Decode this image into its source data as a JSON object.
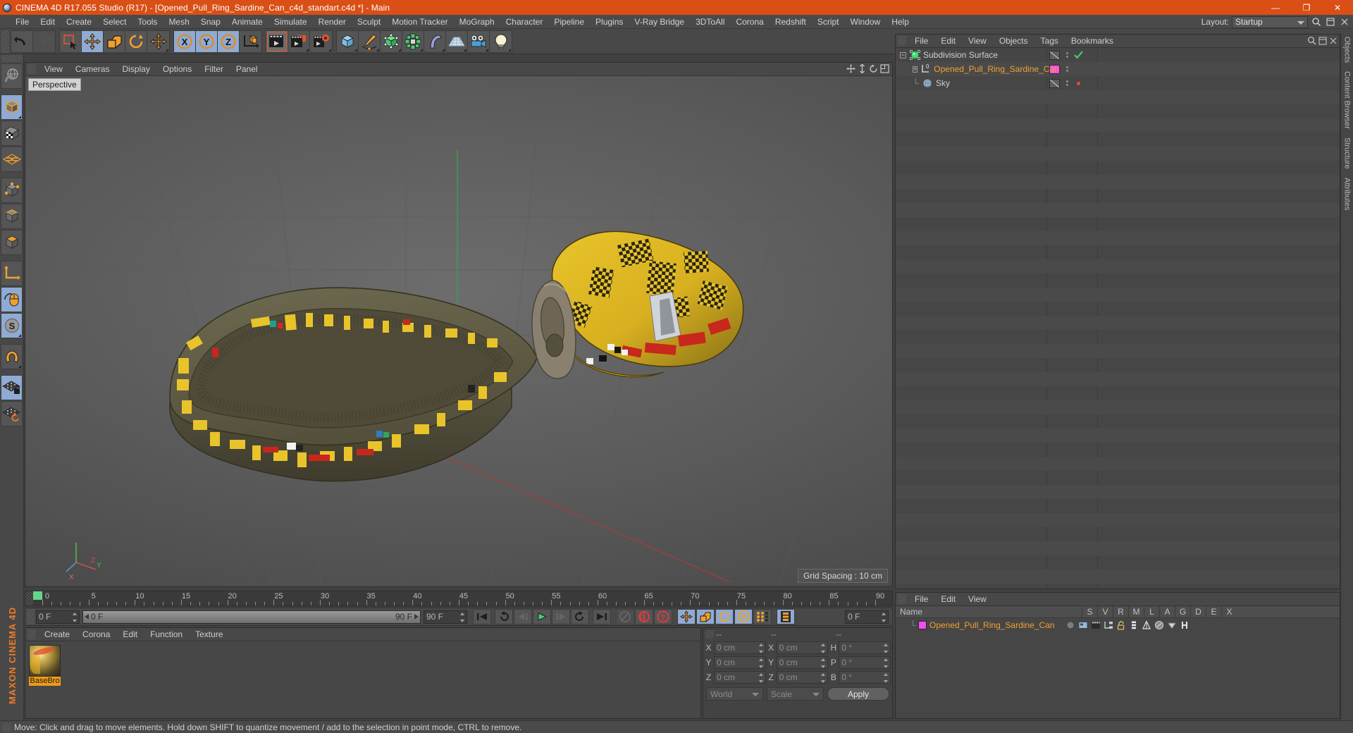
{
  "window": {
    "title": "CINEMA 4D R17.055 Studio (R17) - [Opened_Pull_Ring_Sardine_Can_c4d_standart.c4d *] - Main",
    "minimize": "—",
    "maximize": "❐",
    "close": "✕",
    "accent_color": "#d94f15"
  },
  "menubar": {
    "items": [
      {
        "label": "File"
      },
      {
        "label": "Edit"
      },
      {
        "label": "Create"
      },
      {
        "label": "Select"
      },
      {
        "label": "Tools"
      },
      {
        "label": "Mesh"
      },
      {
        "label": "Snap"
      },
      {
        "label": "Animate"
      },
      {
        "label": "Simulate"
      },
      {
        "label": "Render"
      },
      {
        "label": "Sculpt"
      },
      {
        "label": "Motion Tracker"
      },
      {
        "label": "MoGraph"
      },
      {
        "label": "Character"
      },
      {
        "label": "Pipeline"
      },
      {
        "label": "Plugins"
      },
      {
        "label": "V-Ray Bridge"
      },
      {
        "label": "3DToAll"
      },
      {
        "label": "Corona"
      },
      {
        "label": "Redshift"
      },
      {
        "label": "Script"
      },
      {
        "label": "Window"
      },
      {
        "label": "Help"
      }
    ],
    "layout_label": "Layout:",
    "layout_value": "Startup",
    "search_icon": "search-icon"
  },
  "toolbar": {
    "groups": [
      {
        "name": "history",
        "buttons": [
          {
            "name": "undo-button",
            "icon": "undo-icon"
          },
          {
            "name": "redo-button",
            "icon": "redo-icon"
          }
        ]
      },
      {
        "name": "transform",
        "buttons": [
          {
            "name": "live-selection-button",
            "icon": "selection-icon"
          },
          {
            "name": "move-tool-button",
            "icon": "move-icon",
            "active": true
          },
          {
            "name": "scale-tool-button",
            "icon": "scale-icon"
          },
          {
            "name": "rotate-tool-button",
            "icon": "rotate-icon"
          },
          {
            "name": "move-duplicate-button",
            "icon": "move-icon"
          }
        ]
      },
      {
        "name": "axis-locks",
        "buttons": [
          {
            "name": "lock-x-axis-button",
            "icon": "x-axis-icon",
            "active": true
          },
          {
            "name": "lock-y-axis-button",
            "icon": "y-axis-icon",
            "active": true
          },
          {
            "name": "lock-z-axis-button",
            "icon": "z-axis-icon",
            "active": true
          },
          {
            "name": "world-coordinate-button",
            "icon": "world-axis-icon"
          }
        ]
      },
      {
        "name": "render",
        "buttons": [
          {
            "name": "render-view-button",
            "icon": "render-view-icon"
          },
          {
            "name": "render-to-picture-viewer-button",
            "icon": "render-picture-icon"
          },
          {
            "name": "render-settings-button",
            "icon": "render-settings-icon"
          }
        ]
      },
      {
        "name": "objects",
        "buttons": [
          {
            "name": "add-cube-button",
            "icon": "cube-icon"
          },
          {
            "name": "add-spline-button",
            "icon": "pen-icon"
          },
          {
            "name": "add-generator-button",
            "icon": "generator-icon"
          },
          {
            "name": "add-modeling-object-button",
            "icon": "array-icon"
          },
          {
            "name": "add-deformer-button",
            "icon": "bend-icon"
          },
          {
            "name": "add-scene-object-button",
            "icon": "floor-icon"
          },
          {
            "name": "add-camera-button",
            "icon": "camera-icon"
          },
          {
            "name": "add-light-button",
            "icon": "light-icon"
          }
        ]
      }
    ]
  },
  "left_toolbar": {
    "buttons": [
      {
        "name": "undo-view-button",
        "icon": "globe-view-icon"
      },
      {
        "name": "object-mode-button",
        "icon": "object-mode-icon",
        "active": true
      },
      {
        "name": "texture-mode-button",
        "icon": "texture-mode-icon"
      },
      {
        "name": "polygon-points-button",
        "icon": "points-grid-icon"
      },
      {
        "name": "points-mode-button",
        "icon": "points-mode-icon"
      },
      {
        "name": "edges-mode-button",
        "icon": "edge-mode-icon"
      },
      {
        "name": "polygons-mode-button",
        "icon": "polygon-mode-icon"
      },
      {
        "name": "axis-mode-button",
        "icon": "axis-icon"
      },
      {
        "name": "viewport-solo-button",
        "icon": "mouse-icon",
        "active": true
      },
      {
        "name": "workplane-button",
        "icon": "s-compass-icon",
        "active": true
      },
      {
        "name": "enable-snapping-button",
        "icon": "magnet-icon"
      },
      {
        "name": "lock-workplane-button",
        "icon": "grid-lock-icon",
        "active": true
      },
      {
        "name": "workplane-mode-button",
        "icon": "grid-rotate-icon"
      }
    ],
    "brand": "MAXON CINEMA 4D"
  },
  "viewport": {
    "menu": [
      {
        "label": "View"
      },
      {
        "label": "Cameras"
      },
      {
        "label": "Display"
      },
      {
        "label": "Options"
      },
      {
        "label": "Filter"
      },
      {
        "label": "Panel"
      }
    ],
    "label": "Perspective",
    "grid_spacing": "Grid Spacing : 10 cm",
    "nav_icons": [
      "move-view-icon",
      "scale-view-icon",
      "rotate-view-icon",
      "maximize-view-icon"
    ],
    "axis_gizmo": {
      "x": "X",
      "y": "Y",
      "z": "Z"
    }
  },
  "timeline": {
    "start_frame": "0 F",
    "end_frame": "90 F",
    "current_frame": "0 F",
    "preview_end": "90 F",
    "ticks": [
      0,
      5,
      10,
      15,
      20,
      25,
      30,
      35,
      40,
      45,
      50,
      55,
      60,
      65,
      70,
      75,
      80,
      85,
      90
    ],
    "playhead_frame": 0
  },
  "anim_controls": {
    "buttons": [
      {
        "name": "go-to-start-button",
        "icon": "skip-start-icon"
      },
      {
        "name": "previous-keyframe-button",
        "icon": "prev-key-icon"
      },
      {
        "name": "step-back-button",
        "icon": "step-back-icon"
      },
      {
        "name": "play-button",
        "icon": "play-icon"
      },
      {
        "name": "step-forward-button",
        "icon": "step-forward-icon"
      },
      {
        "name": "next-keyframe-button",
        "icon": "next-key-icon"
      },
      {
        "name": "go-to-end-button",
        "icon": "skip-end-icon"
      },
      {
        "name": "record-active-objects-button",
        "icon": "record-disabled-icon"
      },
      {
        "name": "autokeying-button",
        "icon": "autokey-icon"
      },
      {
        "name": "keyframe-selection-button",
        "icon": "keyframe-select-icon"
      },
      {
        "name": "position-key-button",
        "icon": "position-key-icon",
        "active": true
      },
      {
        "name": "scale-key-button",
        "icon": "scale-key-icon",
        "active": true
      },
      {
        "name": "rotation-key-button",
        "icon": "rotation-key-icon",
        "active": true
      },
      {
        "name": "parameter-key-button",
        "icon": "parameter-key-icon",
        "active": true
      },
      {
        "name": "point-level-animation-button",
        "icon": "pla-icon"
      },
      {
        "name": "timeline-button",
        "icon": "timeline-icon",
        "active": true
      }
    ]
  },
  "material_manager": {
    "menu": [
      {
        "label": "Create"
      },
      {
        "label": "Corona"
      },
      {
        "label": "Edit"
      },
      {
        "label": "Function"
      },
      {
        "label": "Texture"
      }
    ],
    "materials": [
      {
        "name": "BaseBro",
        "selected": true
      }
    ]
  },
  "coordinates": {
    "headers": [
      "--",
      "--",
      "--"
    ],
    "position": {
      "label_x": "X",
      "label_y": "Y",
      "label_z": "Z",
      "x": "0 cm",
      "y": "0 cm",
      "z": "0 cm"
    },
    "size": {
      "label_x": "X",
      "label_y": "Y",
      "label_z": "Z",
      "x": "0 cm",
      "y": "0 cm",
      "z": "0 cm"
    },
    "rotation": {
      "label_h": "H",
      "label_p": "P",
      "label_b": "B",
      "h": "0 °",
      "p": "0 °",
      "b": "0 °"
    },
    "system": "World",
    "mode": "Scale",
    "apply": "Apply"
  },
  "object_manager": {
    "menu": [
      {
        "label": "File"
      },
      {
        "label": "Edit"
      },
      {
        "label": "View"
      },
      {
        "label": "Objects"
      },
      {
        "label": "Tags"
      },
      {
        "label": "Bookmarks"
      }
    ],
    "search_icon": "search-icon",
    "objects": [
      {
        "name": "Subdivision Surface",
        "icon": "subdivision-surface-icon",
        "depth": 0,
        "expander": "−",
        "swatch": "diagonal",
        "state": "check",
        "selected": false
      },
      {
        "name": "Opened_Pull_Ring_Sardine_Can",
        "icon": "polygon-object-icon",
        "depth": 1,
        "expander": "+",
        "swatch": "magenta",
        "state": "none",
        "selected": true
      },
      {
        "name": "Sky",
        "icon": "sky-icon",
        "depth": 1,
        "expander": "",
        "swatch": "diagonal",
        "state": "red",
        "selected": false
      }
    ]
  },
  "tag_manager": {
    "menu": [
      {
        "label": "File"
      },
      {
        "label": "Edit"
      },
      {
        "label": "View"
      }
    ],
    "columns": [
      "Name",
      "S",
      "V",
      "R",
      "M",
      "L",
      "A",
      "G",
      "D",
      "E",
      "X"
    ],
    "rows": [
      {
        "name": "Opened_Pull_Ring_Sardine_Can",
        "selected": true,
        "tags": [
          "dot-icon",
          "display-icon",
          "clapper-icon",
          "connect-icon",
          "unlock-icon",
          "layer-icon",
          "triangle-icon",
          "shield-icon",
          "cone-icon",
          "bone-icon"
        ]
      }
    ]
  },
  "right_tabs": [
    {
      "label": "Objects"
    },
    {
      "label": "Content Browser"
    },
    {
      "label": "Structure"
    },
    {
      "label": "Attributes"
    }
  ],
  "statusbar": {
    "message": "Move: Click and drag to move elements. Hold down SHIFT to quantize movement / add to the selection in point mode, CTRL to remove."
  }
}
